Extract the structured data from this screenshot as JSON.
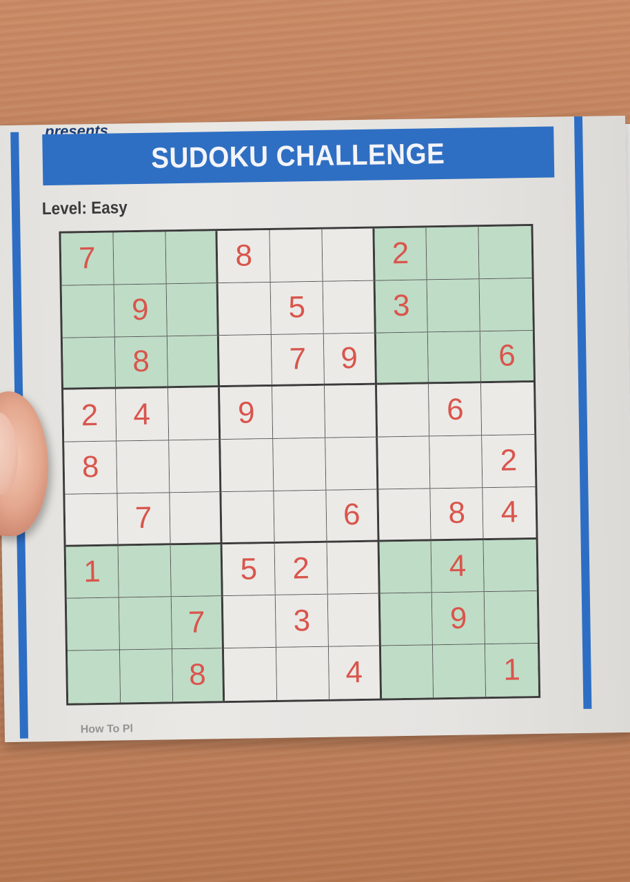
{
  "header": {
    "presents": "presents",
    "title": "SUDOKU CHALLENGE",
    "level": "Level: Easy"
  },
  "footer_fragment": "How To Pl",
  "grid": {
    "shaded_boxes": [
      0,
      2,
      6,
      8
    ],
    "rows": [
      [
        "7",
        "",
        "",
        "8",
        "",
        "",
        "2",
        "",
        ""
      ],
      [
        "",
        "9",
        "",
        "",
        "5",
        "",
        "3",
        "",
        ""
      ],
      [
        "",
        "8",
        "",
        "",
        "7",
        "9",
        "",
        "",
        "6"
      ],
      [
        "2",
        "4",
        "",
        "9",
        "",
        "",
        "",
        "6",
        ""
      ],
      [
        "8",
        "",
        "",
        "",
        "",
        "",
        "",
        "",
        "2"
      ],
      [
        "",
        "7",
        "",
        "",
        "",
        "6",
        "",
        "8",
        "4"
      ],
      [
        "1",
        "",
        "",
        "5",
        "2",
        "",
        "",
        "4",
        ""
      ],
      [
        "",
        "",
        "7",
        "",
        "3",
        "",
        "",
        "9",
        ""
      ],
      [
        "",
        "",
        "8",
        "",
        "",
        "4",
        "",
        "",
        "1"
      ]
    ]
  },
  "colors": {
    "accent_blue": "#2f6fc3",
    "digit_red": "#d9554c",
    "shaded_green": "#bfdcc6"
  }
}
